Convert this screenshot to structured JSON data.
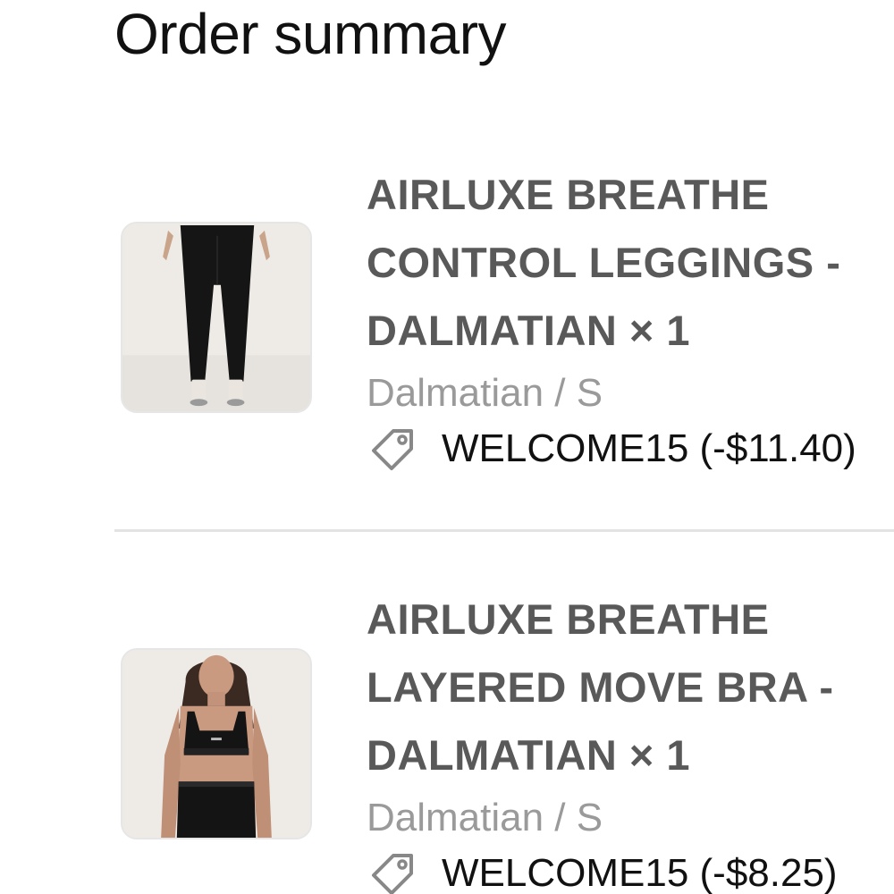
{
  "header": {
    "title": "Order summary"
  },
  "items": [
    {
      "name_lines": [
        "AIRLUXE BREATHE",
        "CONTROL LEGGINGS -",
        "DALMATIAN × 1"
      ],
      "variant": "Dalmatian / S",
      "discount": "WELCOME15 (-$11.40)",
      "image_icon": "leggings-product-image",
      "discount_icon": "tag-icon"
    },
    {
      "name_lines": [
        "AIRLUXE BREATHE",
        "LAYERED MOVE BRA -",
        "DALMATIAN × 1"
      ],
      "variant": "Dalmatian / S",
      "discount": "WELCOME15 (-$8.25)",
      "image_icon": "bra-product-image",
      "discount_icon": "tag-icon"
    }
  ],
  "colors": {
    "title": "#111111",
    "product_name": "#595959",
    "variant": "#9a9a9a",
    "divider": "#e3e3e3",
    "thumb_bg": "#f1efec"
  }
}
